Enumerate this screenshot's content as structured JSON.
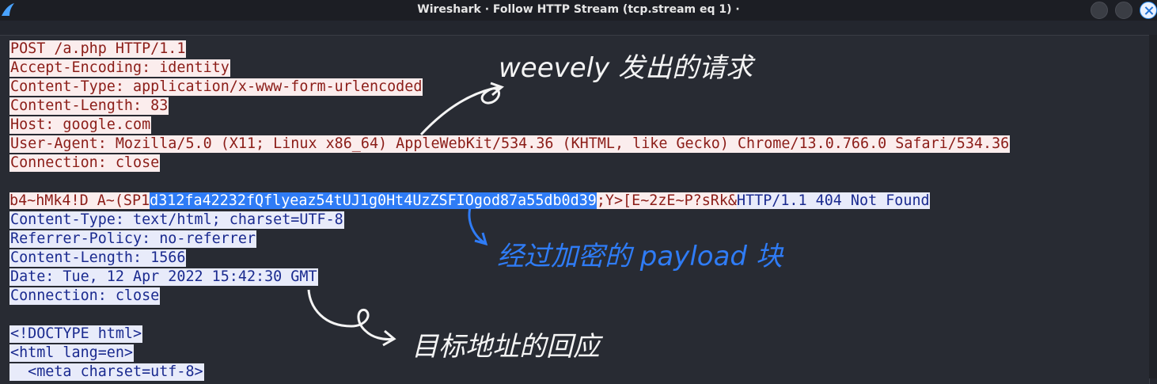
{
  "window": {
    "title": "Wireshark · Follow HTTP Stream (tcp.stream eq 1) ·"
  },
  "request_lines": [
    "POST /a.php HTTP/1.1",
    "Accept-Encoding: identity",
    "Content-Type: application/x-www-form-urlencoded",
    "Content-Length: 83",
    "Host: google.com",
    "User-Agent: Mozilla/5.0 (X11; Linux x86_64) AppleWebKit/534.36 (KHTML, like Gecko) Chrome/13.0.766.0 Safari/534.36",
    "Connection: close"
  ],
  "payload_line": {
    "prefix": "b4~hMk4!D A~(SP1",
    "selected": "d312fa42232fQflyeaz54tUJ1g0Ht4UzZSFIOgod87a55db0d39",
    "suffix": ";Y>[E~2zE~P?sRk&",
    "response_start": "HTTP/1.1 404 Not Found"
  },
  "response_lines": [
    "Content-Type: text/html; charset=UTF-8",
    "Referrer-Policy: no-referrer",
    "Content-Length: 1566",
    "Date: Tue, 12 Apr 2022 15:42:30 GMT",
    "Connection: close"
  ],
  "body_lines": [
    "<!DOCTYPE html>",
    "<html lang=en>",
    "  <meta charset=utf-8>"
  ],
  "annotations": {
    "request_note": "weevely 发出的请求",
    "payload_note": "经过加密的 payload 块",
    "response_note": "目标地址的回应"
  },
  "colors": {
    "request_bg": "#fbeded",
    "request_text": "#8b1d18",
    "response_bg": "#e8ebfa",
    "response_text": "#1a2a8f",
    "selection": "#2f7cf6"
  }
}
